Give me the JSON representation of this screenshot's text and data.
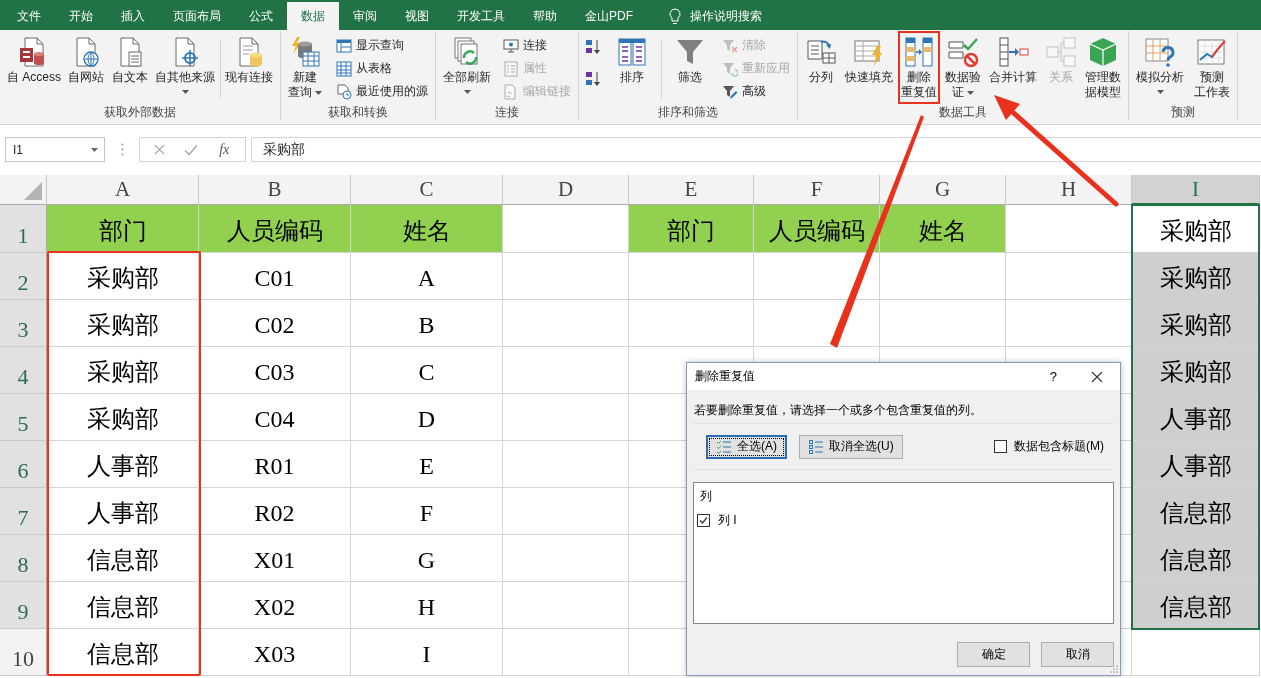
{
  "menu_tabs": [
    {
      "label": "文件",
      "selected": false
    },
    {
      "label": "开始",
      "selected": false
    },
    {
      "label": "插入",
      "selected": false
    },
    {
      "label": "页面布局",
      "selected": false
    },
    {
      "label": "公式",
      "selected": false
    },
    {
      "label": "数据",
      "selected": true
    },
    {
      "label": "审阅",
      "selected": false
    },
    {
      "label": "视图",
      "selected": false
    },
    {
      "label": "开发工具",
      "selected": false
    },
    {
      "label": "帮助",
      "selected": false
    },
    {
      "label": "金山PDF",
      "selected": false
    }
  ],
  "tell_me": {
    "placeholder": "操作说明搜索"
  },
  "ribbon_groups": [
    {
      "title": "获取外部数据",
      "items": [
        {
          "kind": "large",
          "label": "自 Access",
          "dropdown": false,
          "disabled": false,
          "highlighted": false
        },
        {
          "kind": "large",
          "label": "自网站",
          "dropdown": false,
          "disabled": false,
          "highlighted": false
        },
        {
          "kind": "large",
          "label": "自文本",
          "dropdown": false,
          "disabled": false,
          "highlighted": false
        },
        {
          "kind": "large",
          "label": "自其他来源",
          "dropdown": true,
          "disabled": false,
          "highlighted": false
        },
        {
          "kind": "divider"
        },
        {
          "kind": "large",
          "label": "现有连接",
          "dropdown": false,
          "disabled": false,
          "highlighted": false
        }
      ]
    },
    {
      "title": "获取和转换",
      "items": [
        {
          "kind": "large",
          "label": "新建查询",
          "dropdown": true,
          "disabled": false,
          "highlighted": false
        },
        {
          "kind": "stack",
          "items": [
            {
              "label": "显示查询",
              "disabled": false
            },
            {
              "label": "从表格",
              "disabled": false
            },
            {
              "label": "最近使用的源",
              "disabled": false
            }
          ]
        }
      ]
    },
    {
      "title": "连接",
      "items": [
        {
          "kind": "large",
          "label": "全部刷新",
          "dropdown": true,
          "disabled": false,
          "highlighted": false
        },
        {
          "kind": "stack",
          "items": [
            {
              "label": "连接",
              "disabled": false
            },
            {
              "label": "属性",
              "disabled": true
            },
            {
              "label": "编辑链接",
              "disabled": true
            }
          ]
        }
      ]
    },
    {
      "title": "排序和筛选",
      "items": [
        {
          "kind": "icon_stack"
        },
        {
          "kind": "large",
          "label": "排序",
          "dropdown": false,
          "disabled": false,
          "highlighted": false
        },
        {
          "kind": "divider"
        },
        {
          "kind": "large",
          "label": "筛选",
          "dropdown": false,
          "disabled": false,
          "highlighted": false
        },
        {
          "kind": "stack",
          "items": [
            {
              "label": "清除",
              "disabled": true
            },
            {
              "label": "重新应用",
              "disabled": true
            },
            {
              "label": "高级",
              "disabled": false
            }
          ]
        }
      ]
    },
    {
      "title": "数据工具",
      "items": [
        {
          "kind": "large",
          "label": "分列",
          "dropdown": false,
          "disabled": false,
          "highlighted": false
        },
        {
          "kind": "large",
          "label": "快速填充",
          "dropdown": false,
          "disabled": false,
          "highlighted": false
        },
        {
          "kind": "large",
          "label": "删除重复值",
          "dropdown": false,
          "disabled": false,
          "highlighted": true
        },
        {
          "kind": "large",
          "label": "数据验证",
          "dropdown": true,
          "disabled": false,
          "highlighted": false
        },
        {
          "kind": "large",
          "label": "合并计算",
          "dropdown": false,
          "disabled": false,
          "highlighted": false
        },
        {
          "kind": "large",
          "label": "关系",
          "dropdown": false,
          "disabled": true,
          "highlighted": false
        },
        {
          "kind": "large",
          "label": "管理数据模型",
          "dropdown": false,
          "disabled": false,
          "highlighted": false
        }
      ]
    },
    {
      "title": "预测",
      "items": [
        {
          "kind": "large",
          "label": "模拟分析",
          "dropdown": true,
          "disabled": false,
          "highlighted": false
        },
        {
          "kind": "large",
          "label": "预测工作表",
          "dropdown": false,
          "disabled": false,
          "highlighted": false
        }
      ]
    }
  ],
  "formula_bar": {
    "name_box": "I1",
    "function_button": "fx",
    "formula": "采购部"
  },
  "sheet": {
    "columns": [
      {
        "label": "A",
        "selected": false
      },
      {
        "label": "B",
        "selected": false
      },
      {
        "label": "C",
        "selected": false
      },
      {
        "label": "D",
        "selected": false
      },
      {
        "label": "E",
        "selected": false
      },
      {
        "label": "F",
        "selected": false
      },
      {
        "label": "G",
        "selected": false
      },
      {
        "label": "H",
        "selected": false
      },
      {
        "label": "I",
        "selected": true
      }
    ],
    "rows": [
      {
        "number": "1",
        "selected": true,
        "cells": [
          {
            "text": "部门",
            "color": "#92d050"
          },
          {
            "text": "人员编码",
            "color": "#92d050"
          },
          {
            "text": "姓名",
            "color": "#92d050"
          },
          null,
          {
            "text": "部门",
            "color": "#92d050"
          },
          {
            "text": "人员编码",
            "color": "#92d050"
          },
          {
            "text": "姓名",
            "color": "#92d050"
          },
          null,
          {
            "text": "采购部"
          }
        ]
      },
      {
        "number": "2",
        "selected": true,
        "cells": [
          {
            "text": "采购部"
          },
          {
            "text": "C01"
          },
          {
            "text": "A"
          },
          null,
          null,
          null,
          null,
          null,
          {
            "text": "采购部"
          }
        ]
      },
      {
        "number": "3",
        "selected": true,
        "cells": [
          {
            "text": "采购部"
          },
          {
            "text": "C02"
          },
          {
            "text": "B"
          },
          null,
          null,
          null,
          null,
          null,
          {
            "text": "采购部"
          }
        ]
      },
      {
        "number": "4",
        "selected": true,
        "cells": [
          {
            "text": "采购部"
          },
          {
            "text": "C03"
          },
          {
            "text": "C"
          },
          null,
          null,
          null,
          null,
          null,
          {
            "text": "采购部"
          }
        ]
      },
      {
        "number": "5",
        "selected": true,
        "cells": [
          {
            "text": "采购部"
          },
          {
            "text": "C04"
          },
          {
            "text": "D"
          },
          null,
          null,
          null,
          null,
          null,
          {
            "text": "人事部"
          }
        ]
      },
      {
        "number": "6",
        "selected": true,
        "cells": [
          {
            "text": "人事部"
          },
          {
            "text": "R01"
          },
          {
            "text": "E"
          },
          null,
          null,
          null,
          null,
          null,
          {
            "text": "人事部"
          }
        ]
      },
      {
        "number": "7",
        "selected": true,
        "cells": [
          {
            "text": "人事部"
          },
          {
            "text": "R02"
          },
          {
            "text": "F"
          },
          null,
          null,
          null,
          null,
          null,
          {
            "text": "信息部"
          }
        ]
      },
      {
        "number": "8",
        "selected": true,
        "cells": [
          {
            "text": "信息部"
          },
          {
            "text": "X01"
          },
          {
            "text": "G"
          },
          null,
          null,
          null,
          null,
          null,
          {
            "text": "信息部"
          }
        ]
      },
      {
        "number": "9",
        "selected": true,
        "cells": [
          {
            "text": "信息部"
          },
          {
            "text": "X02"
          },
          {
            "text": "H"
          },
          null,
          null,
          null,
          null,
          null,
          {
            "text": "信息部"
          }
        ]
      },
      {
        "number": "10",
        "selected": false,
        "cells": [
          {
            "text": "信息部"
          },
          {
            "text": "X03"
          },
          {
            "text": "I"
          },
          null,
          null,
          null,
          null,
          null,
          null
        ]
      }
    ]
  },
  "dialog": {
    "title": "删除重复值",
    "help": "?",
    "message": "若要删除重复值，请选择一个或多个包含重复值的列。",
    "select_buttons": [
      {
        "label": "全选(A)",
        "focused": true
      },
      {
        "label": "取消全选(U)",
        "focused": false
      }
    ],
    "header_option": {
      "label": "数据包含标题(M)",
      "checked": false
    },
    "column_list": {
      "header": "列",
      "items": [
        {
          "label": "列 I",
          "checked": true
        }
      ]
    },
    "buttons": [
      "确定",
      "取消"
    ]
  }
}
